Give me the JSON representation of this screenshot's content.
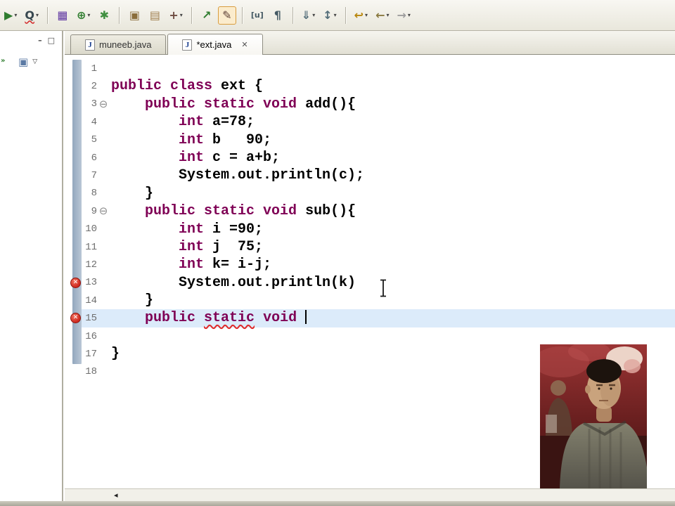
{
  "colors": {
    "keyword": "#7f0055",
    "current_line": "#dcebfa",
    "ruler_start": "#93a7bd",
    "ruler_end": "#b9c7d6",
    "error": "#cf2a20"
  },
  "toolbar": {
    "caret_glyph": "▾",
    "items": [
      {
        "name": "run-icon",
        "glyph": "▶",
        "color": "#2f7d2f",
        "caret": true
      },
      {
        "name": "external-tools-icon",
        "glyph": "Q",
        "color": "#37474f",
        "caret": true,
        "wavy": true
      },
      {
        "sep": true
      },
      {
        "name": "new-table-icon",
        "glyph": "▦",
        "color": "#5e35a1"
      },
      {
        "name": "web-browser-icon",
        "glyph": "⊕",
        "color": "#2f7d2f",
        "caret": true
      },
      {
        "name": "new-snippet-icon",
        "glyph": "✱",
        "color": "#3f8f3f"
      },
      {
        "sep": true
      },
      {
        "name": "java-package-icon",
        "glyph": "▣",
        "color": "#8a6d3b"
      },
      {
        "name": "open-folder-icon",
        "glyph": "▤",
        "color": "#a07f4f"
      },
      {
        "name": "tools-icon",
        "glyph": "+",
        "color": "#6d4c41",
        "caret": true
      },
      {
        "sep": true
      },
      {
        "name": "run-to-line-icon",
        "glyph": "↗",
        "color": "#2f7d2f"
      },
      {
        "name": "pencil-tool-icon",
        "glyph": "✎",
        "color": "#5d4037",
        "selected": true
      },
      {
        "sep": true
      },
      {
        "name": "show-source-icon",
        "glyph": "[u]",
        "color": "#455a64",
        "small": true
      },
      {
        "name": "show-whitespace-icon",
        "glyph": "¶",
        "color": "#455a64"
      },
      {
        "sep": true
      },
      {
        "name": "save-all-icon",
        "glyph": "⇓",
        "color": "#546e7a",
        "caret": true
      },
      {
        "name": "sync-icon",
        "glyph": "↕",
        "color": "#546e7a",
        "caret": true
      },
      {
        "sep": true
      },
      {
        "name": "last-edit-location-icon",
        "glyph": "↩",
        "color": "#b8860b",
        "caret": true
      },
      {
        "name": "back-icon",
        "glyph": "←",
        "color": "#8a7a40",
        "caret": true
      },
      {
        "name": "forward-icon",
        "glyph": "→",
        "color": "#9e9e9e",
        "caret": true
      }
    ]
  },
  "left_panel": {
    "minimize_glyph": "–",
    "restore_glyph": "□",
    "fast_arrow_glyph": "»",
    "stack_glyph": "▣",
    "menu_glyph": "▽"
  },
  "java_icon_glyph": "J",
  "tabs": [
    {
      "id": "muneeb",
      "label": "muneeb.java",
      "active": false,
      "close": false,
      "close_glyph": ""
    },
    {
      "id": "ext",
      "label": "*ext.java",
      "active": true,
      "close": true,
      "close_glyph": "✕"
    }
  ],
  "editor": {
    "current_line": 15,
    "caret_line": 15,
    "fold_glyph": "⊖",
    "error_glyph": "✕",
    "lines": [
      {
        "n": 1,
        "seg": []
      },
      {
        "n": 2,
        "seg": [
          {
            "t": "public class ",
            "c": "kw"
          },
          {
            "t": "ext {",
            "c": "pl"
          }
        ]
      },
      {
        "n": 3,
        "fold": true,
        "seg": [
          {
            "t": "    ",
            "c": "pl"
          },
          {
            "t": "public static void ",
            "c": "kw"
          },
          {
            "t": "add(){",
            "c": "pl"
          }
        ]
      },
      {
        "n": 4,
        "seg": [
          {
            "t": "        ",
            "c": "pl"
          },
          {
            "t": "int",
            "c": "kw"
          },
          {
            "t": " a=78;",
            "c": "pl"
          }
        ]
      },
      {
        "n": 5,
        "seg": [
          {
            "t": "        ",
            "c": "pl"
          },
          {
            "t": "int",
            "c": "kw"
          },
          {
            "t": " b   90;",
            "c": "pl"
          }
        ]
      },
      {
        "n": 6,
        "seg": [
          {
            "t": "        ",
            "c": "pl"
          },
          {
            "t": "int",
            "c": "kw"
          },
          {
            "t": " c = a+b;",
            "c": "pl"
          }
        ]
      },
      {
        "n": 7,
        "seg": [
          {
            "t": "        ",
            "c": "pl"
          },
          {
            "t": "System.out.println(c);",
            "c": "pl"
          }
        ]
      },
      {
        "n": 8,
        "seg": [
          {
            "t": "    }",
            "c": "pl"
          }
        ]
      },
      {
        "n": 9,
        "fold": true,
        "seg": [
          {
            "t": "    ",
            "c": "pl"
          },
          {
            "t": "public static void ",
            "c": "kw"
          },
          {
            "t": "sub(){",
            "c": "pl"
          }
        ]
      },
      {
        "n": 10,
        "seg": [
          {
            "t": "        ",
            "c": "pl"
          },
          {
            "t": "int",
            "c": "kw"
          },
          {
            "t": " i =90;",
            "c": "pl"
          }
        ]
      },
      {
        "n": 11,
        "seg": [
          {
            "t": "        ",
            "c": "pl"
          },
          {
            "t": "int",
            "c": "kw"
          },
          {
            "t": " j  75;",
            "c": "pl"
          }
        ]
      },
      {
        "n": 12,
        "seg": [
          {
            "t": "        ",
            "c": "pl"
          },
          {
            "t": "int",
            "c": "kw"
          },
          {
            "t": " k= i-j;",
            "c": "pl"
          }
        ]
      },
      {
        "n": 13,
        "err": true,
        "seg": [
          {
            "t": "        ",
            "c": "pl"
          },
          {
            "t": "System.out.println(k)",
            "c": "pl"
          }
        ]
      },
      {
        "n": 14,
        "seg": [
          {
            "t": "    }",
            "c": "pl"
          }
        ]
      },
      {
        "n": 15,
        "err": true,
        "seg": [
          {
            "t": "    ",
            "c": "pl"
          },
          {
            "t": "public ",
            "c": "kw"
          },
          {
            "t": "static",
            "c": "kw err"
          },
          {
            "t": " ",
            "c": "pl"
          },
          {
            "t": "void ",
            "c": "kw"
          }
        ]
      },
      {
        "n": 16,
        "seg": []
      },
      {
        "n": 17,
        "seg": [
          {
            "t": "}",
            "c": "pl"
          }
        ]
      },
      {
        "n": 18,
        "seg": []
      }
    ]
  },
  "scrollbar": {
    "left_glyph": "◂"
  }
}
